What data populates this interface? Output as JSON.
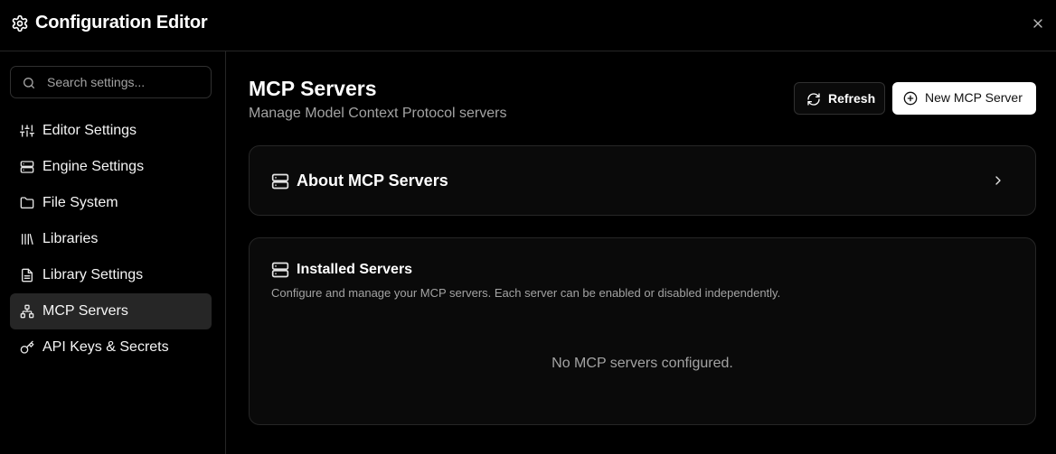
{
  "window": {
    "title": "Configuration Editor"
  },
  "search": {
    "placeholder": "Search settings..."
  },
  "sidebar": {
    "items": [
      {
        "label": "Editor Settings",
        "icon": "sliders-icon",
        "active": false
      },
      {
        "label": "Engine Settings",
        "icon": "server-icon",
        "active": false
      },
      {
        "label": "File System",
        "icon": "folder-icon",
        "active": false
      },
      {
        "label": "Libraries",
        "icon": "library-icon",
        "active": false
      },
      {
        "label": "Library Settings",
        "icon": "file-icon",
        "active": false
      },
      {
        "label": "MCP Servers",
        "icon": "network-icon",
        "active": true
      },
      {
        "label": "API Keys & Secrets",
        "icon": "key-icon",
        "active": false
      }
    ]
  },
  "main": {
    "title": "MCP Servers",
    "subtitle": "Manage Model Context Protocol servers",
    "refresh_label": "Refresh",
    "new_server_label": "New MCP Server",
    "about_card": {
      "title": "About MCP Servers"
    },
    "installed_card": {
      "title": "Installed Servers",
      "description": "Configure and manage your MCP servers. Each server can be enabled or disabled independently.",
      "empty_text": "No MCP servers configured."
    }
  },
  "colors": {
    "background": "#000000",
    "card": "#0a0a0a",
    "border": "#262626",
    "active_item": "#262626",
    "muted_text": "#a3a3a3",
    "primary_button": "#ffffff"
  }
}
